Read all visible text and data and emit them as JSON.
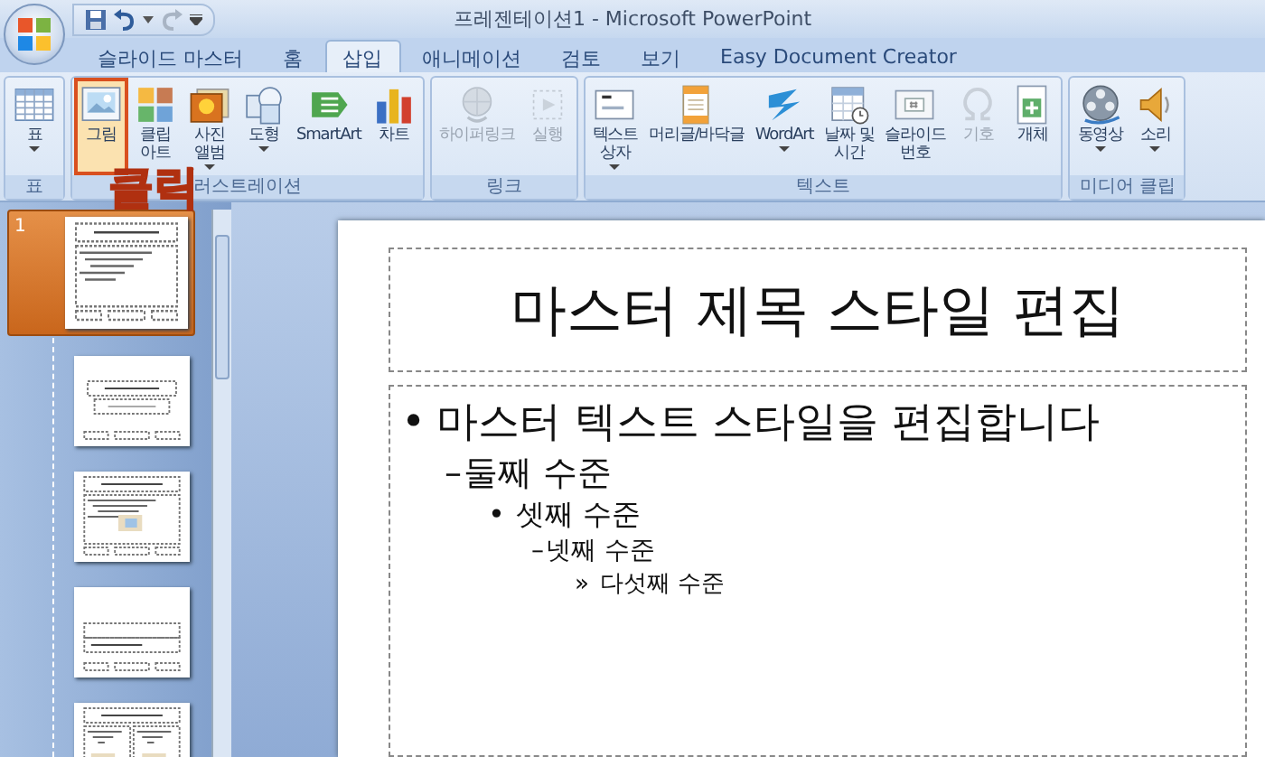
{
  "window": {
    "title": "프레젠테이션1 - Microsoft PowerPoint"
  },
  "tabs": [
    {
      "label": "슬라이드 마스터",
      "selected": false
    },
    {
      "label": "홈",
      "selected": false
    },
    {
      "label": "삽입",
      "selected": true
    },
    {
      "label": "애니메이션",
      "selected": false
    },
    {
      "label": "검토",
      "selected": false
    },
    {
      "label": "보기",
      "selected": false
    },
    {
      "label": "Easy Document Creator",
      "selected": false
    }
  ],
  "ribbon_groups": [
    {
      "label": "표",
      "buttons": [
        {
          "label": "표",
          "kind": "table",
          "dropdown": true,
          "disabled": false,
          "highlighted": false
        }
      ]
    },
    {
      "label": "러스트레이션",
      "buttons": [
        {
          "label": "그림",
          "kind": "picture",
          "dropdown": false,
          "disabled": false,
          "highlighted": true
        },
        {
          "label": "클립\n아트",
          "kind": "clipart",
          "dropdown": false,
          "disabled": false,
          "highlighted": false
        },
        {
          "label": "사진\n앨범",
          "kind": "photo",
          "dropdown": true,
          "disabled": false,
          "highlighted": false
        },
        {
          "label": "도형",
          "kind": "shapes",
          "dropdown": true,
          "disabled": false,
          "highlighted": false
        },
        {
          "label": "SmartArt",
          "kind": "smartart",
          "dropdown": false,
          "disabled": false,
          "highlighted": false
        },
        {
          "label": "차트",
          "kind": "chart",
          "dropdown": false,
          "disabled": false,
          "highlighted": false
        }
      ]
    },
    {
      "label": "링크",
      "buttons": [
        {
          "label": "하이퍼링크",
          "kind": "hyperlink",
          "dropdown": false,
          "disabled": true,
          "highlighted": false
        },
        {
          "label": "실행",
          "kind": "action",
          "dropdown": false,
          "disabled": true,
          "highlighted": false
        }
      ]
    },
    {
      "label": "텍스트",
      "buttons": [
        {
          "label": "텍스트\n상자",
          "kind": "textbox",
          "dropdown": true,
          "disabled": false,
          "highlighted": false
        },
        {
          "label": "머리글/바닥글",
          "kind": "headerfooter",
          "dropdown": false,
          "disabled": false,
          "highlighted": false
        },
        {
          "label": "WordArt",
          "kind": "wordart",
          "dropdown": true,
          "disabled": false,
          "highlighted": false
        },
        {
          "label": "날짜 및\n시간",
          "kind": "datetime",
          "dropdown": false,
          "disabled": false,
          "highlighted": false
        },
        {
          "label": "슬라이드\n번호",
          "kind": "slidenumber",
          "dropdown": false,
          "disabled": false,
          "highlighted": false
        },
        {
          "label": "기호",
          "kind": "symbol",
          "dropdown": false,
          "disabled": true,
          "highlighted": false
        },
        {
          "label": "개체",
          "kind": "object",
          "dropdown": false,
          "disabled": false,
          "highlighted": false
        }
      ]
    },
    {
      "label": "미디어 클립",
      "buttons": [
        {
          "label": "동영상",
          "kind": "movie",
          "dropdown": true,
          "disabled": false,
          "highlighted": false
        },
        {
          "label": "소리",
          "kind": "sound",
          "dropdown": true,
          "disabled": false,
          "highlighted": false
        }
      ]
    }
  ],
  "annotation": {
    "label": "클릭"
  },
  "thumbnails": [
    {
      "number": "1",
      "kind": "master",
      "selected": true
    },
    {
      "kind": "title",
      "selected": false
    },
    {
      "kind": "content",
      "selected": false
    },
    {
      "kind": "section",
      "selected": false
    },
    {
      "kind": "two-content",
      "selected": false
    }
  ],
  "slide": {
    "title": "마스터 제목 스타일 편집",
    "bullets": [
      {
        "bullet": "•",
        "text": "마스터 텍스트 스타일을 편집합니다",
        "children": [
          {
            "bullet": "–",
            "text": "둘째 수준",
            "children": [
              {
                "bullet": "•",
                "text": "셋째 수준",
                "children": [
                  {
                    "bullet": "–",
                    "text": "넷째 수준",
                    "children": [
                      {
                        "bullet": "»",
                        "text": "다섯째 수준"
                      }
                    ]
                  }
                ]
              }
            ]
          }
        ]
      }
    ]
  }
}
